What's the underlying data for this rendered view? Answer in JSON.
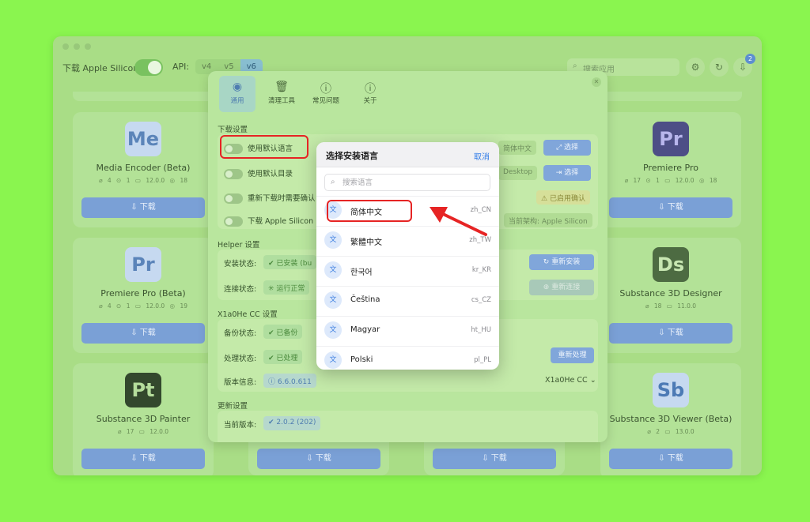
{
  "topbar": {
    "download_label": "下载 Apple Silicon",
    "api_label": "API:",
    "api_versions": [
      "v4",
      "v5",
      "v6"
    ],
    "search_placeholder": "搜索应用",
    "notification_count": "2"
  },
  "cards": [
    {
      "name": "Media Encoder (Beta)",
      "icon_text": "Me",
      "meta": "⌀ 4   ⊙ 1   ▭ 12.0.0   ◎ 18",
      "button": "下载"
    },
    {
      "name": "Premiere Pro",
      "icon_text": "Pr",
      "meta": "⌀ 17   ⊙ 1   ▭ 12.0.0   ◎ 18",
      "button": "下载"
    },
    {
      "name": "Premiere Pro (Beta)",
      "icon_text": "Pr",
      "meta": "⌀ 4   ⊙ 1   ▭ 12.0.0   ◎ 19",
      "button": "下载"
    },
    {
      "name": "Substance 3D Designer",
      "icon_text": "Ds",
      "meta": "⌀ 18   ▭ 11.0.0",
      "button": "下载"
    },
    {
      "name": "Substance 3D Painter",
      "icon_text": "Pt",
      "meta": "⌀ 17   ▭ 12.0.0",
      "button": "下载"
    },
    {
      "name": "Substance 3D Viewer (Beta)",
      "icon_text": "Sb",
      "meta": "⌀ 2   ▭ 13.0.0",
      "button": "下载"
    },
    {
      "button": "下载"
    },
    {
      "button": "下载"
    }
  ],
  "settings": {
    "tabs": [
      "通用",
      "清理工具",
      "常见问题",
      "关于"
    ],
    "download_section": "下载设置",
    "use_default_language": "使用默认语言",
    "language_value": "简体中文",
    "choose": "选择",
    "use_default_dir": "使用默认目录",
    "dir_value": "Desktop",
    "redownload_confirm": "重新下载时需要确认",
    "confirm_enabled": "已启用确认",
    "download_apple_silicon": "下载 Apple Silicon",
    "current_arch": "当前架构: Apple Silicon",
    "helper_section": "Helper 设置",
    "install_status_label": "安装状态:",
    "install_status_value": "已安装 (bu",
    "reinstall": "重新安装",
    "connect_status_label": "连接状态:",
    "connect_status_value": "运行正常",
    "reconnect": "重新连接",
    "x1_section": "X1a0He CC 设置",
    "backup_label": "备份状态:",
    "backup_value": "已备份",
    "process_label": "处理状态:",
    "process_value": "已处理",
    "reprocess": "重新处理",
    "version_label": "版本信息:",
    "version_value": "6.6.0.611",
    "version_select": "X1a0He CC",
    "update_section": "更新设置",
    "current_version_label": "当前版本:",
    "current_version_value": "2.0.2 (202)"
  },
  "picker": {
    "title": "选择安装语言",
    "cancel": "取消",
    "search_placeholder": "搜索语言",
    "languages": [
      {
        "name": "简体中文",
        "code": "zh_CN"
      },
      {
        "name": "繁體中文",
        "code": "zh_TW"
      },
      {
        "name": "한국어",
        "code": "kr_KR"
      },
      {
        "name": "Čeština",
        "code": "cs_CZ"
      },
      {
        "name": "Magyar",
        "code": "ht_HU"
      },
      {
        "name": "Polski",
        "code": "pl_PL"
      }
    ]
  },
  "colors": {
    "background": "#8af54f",
    "highlight": "#e62424",
    "accent_blue": "#2f7be8"
  }
}
